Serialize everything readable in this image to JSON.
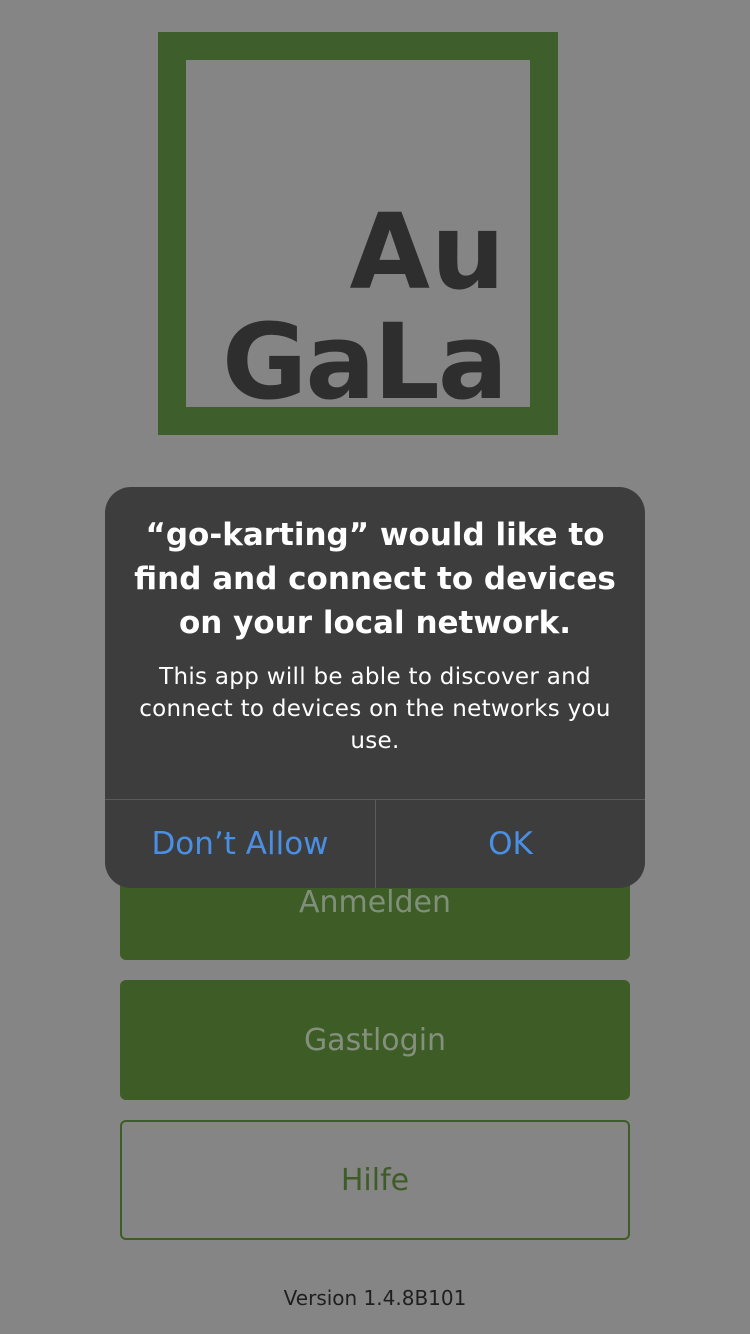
{
  "logo": {
    "line1": "Au",
    "line2": "GaLa",
    "frame_color": "#3e5e2c",
    "text_color": "#2e2e2e"
  },
  "buttons": {
    "login_label": "Anmelden",
    "guest_label": "Gastlogin",
    "help_label": "Hilfe",
    "accent_color": "#3e5c26"
  },
  "version": "Version 1.4.8B101",
  "alert": {
    "title": "“go-karting” would like to find and connect to devices on your local network.",
    "message": "This app will be able to discover and connect to devices on the networks you use.",
    "deny_label": "Don’t Allow",
    "ok_label": "OK",
    "button_color": "#4a8fe3"
  }
}
